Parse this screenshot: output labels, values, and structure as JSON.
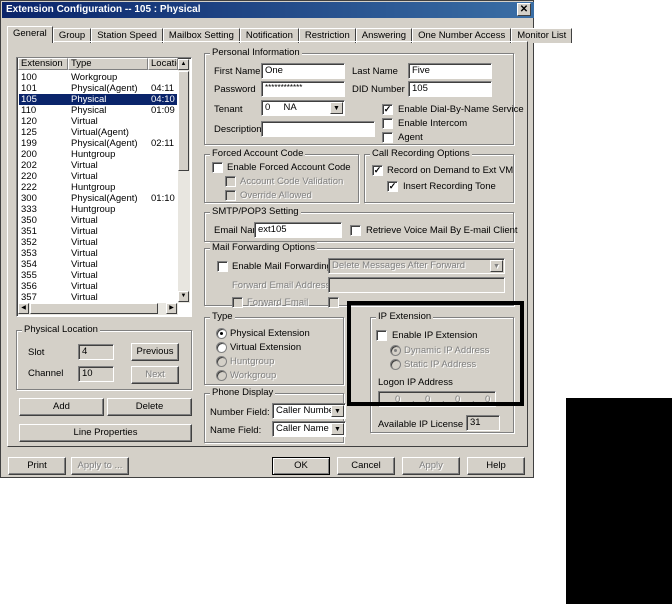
{
  "window": {
    "title": "Extension Configuration -- 105 : Physical",
    "close": "✕"
  },
  "tabs": [
    "General",
    "Group",
    "Station Speed",
    "Mailbox Setting",
    "Notification",
    "Restriction",
    "Answering",
    "One Number Access",
    "Monitor List"
  ],
  "ext_list": {
    "headers": [
      "Extension",
      "Type",
      "Locatio"
    ],
    "rows": [
      [
        "100",
        "Workgroup",
        ""
      ],
      [
        "101",
        "Physical(Agent)",
        "04:11"
      ],
      [
        "105",
        "Physical",
        "04:10"
      ],
      [
        "110",
        "Physical",
        "01:09"
      ],
      [
        "120",
        "Virtual",
        ""
      ],
      [
        "125",
        "Virtual(Agent)",
        ""
      ],
      [
        "199",
        "Physical(Agent)",
        "02:11"
      ],
      [
        "200",
        "Huntgroup",
        ""
      ],
      [
        "202",
        "Virtual",
        ""
      ],
      [
        "220",
        "Virtual",
        ""
      ],
      [
        "222",
        "Huntgroup",
        ""
      ],
      [
        "300",
        "Physical(Agent)",
        "01:10"
      ],
      [
        "333",
        "Huntgroup",
        ""
      ],
      [
        "350",
        "Virtual",
        ""
      ],
      [
        "351",
        "Virtual",
        ""
      ],
      [
        "352",
        "Virtual",
        ""
      ],
      [
        "353",
        "Virtual",
        ""
      ],
      [
        "354",
        "Virtual",
        ""
      ],
      [
        "355",
        "Virtual",
        ""
      ],
      [
        "356",
        "Virtual",
        ""
      ],
      [
        "357",
        "Virtual",
        ""
      ]
    ],
    "selected_index": 2
  },
  "physical_location": {
    "legend": "Physical Location",
    "slot_label": "Slot",
    "slot_value": "4",
    "channel_label": "Channel",
    "channel_value": "10",
    "previous": "Previous",
    "next": "Next"
  },
  "left_buttons": {
    "add": "Add",
    "delete": "Delete",
    "line_properties": "Line Properties"
  },
  "personal": {
    "legend": "Personal Information",
    "first_name_label": "First Name",
    "first_name": "One",
    "last_name_label": "Last Name",
    "last_name": "Five",
    "password_label": "Password",
    "password": "************",
    "did_label": "DID Number",
    "did": "105",
    "tenant_label": "Tenant",
    "tenant": "0     NA",
    "description_label": "Description",
    "description": "",
    "dial_by_name": "Enable Dial-By-Name Service",
    "intercom": "Enable Intercom",
    "agent": "Agent"
  },
  "forced_account": {
    "legend": "Forced Account Code",
    "enable": "Enable Forced Account Code",
    "validation": "Account Code Validation",
    "override": "Override Allowed"
  },
  "call_recording": {
    "legend": "Call Recording Options",
    "record": "Record on Demand to Ext VM",
    "tone": "Insert Recording Tone"
  },
  "smtp": {
    "legend": "SMTP/POP3 Setting",
    "email_label": "Email Name",
    "email": "ext105",
    "retrieve": "Retrieve Voice Mail By E-mail Client"
  },
  "mail_forwarding": {
    "legend": "Mail Forwarding Options",
    "enable": "Enable Mail Forwarding",
    "option": "Delete Messages After Forward",
    "addr_label": "Forward Email Address",
    "forward_email": "Forward Email"
  },
  "type_group": {
    "legend": "Type",
    "options": [
      "Physical Extension",
      "Virtual Extension",
      "Huntgroup",
      "Workgroup"
    ]
  },
  "phone_display": {
    "legend": "Phone Display",
    "number_label": "Number Field:",
    "number_value": "Caller Number",
    "name_label": "Name Field:",
    "name_value": "Caller Name"
  },
  "ip_extension": {
    "legend": "IP Extension",
    "enable": "Enable IP Extension",
    "dynamic": "Dynamic IP Address",
    "static": "Static IP Address",
    "logon_label": "Logon IP Address",
    "ip": [
      "0",
      "0",
      "0",
      "0"
    ],
    "license_label": "Available IP License",
    "license": "31"
  },
  "bottom": {
    "print": "Print",
    "apply_to": "Apply to ...",
    "ok": "OK",
    "cancel": "Cancel",
    "apply": "Apply",
    "help": "Help"
  }
}
